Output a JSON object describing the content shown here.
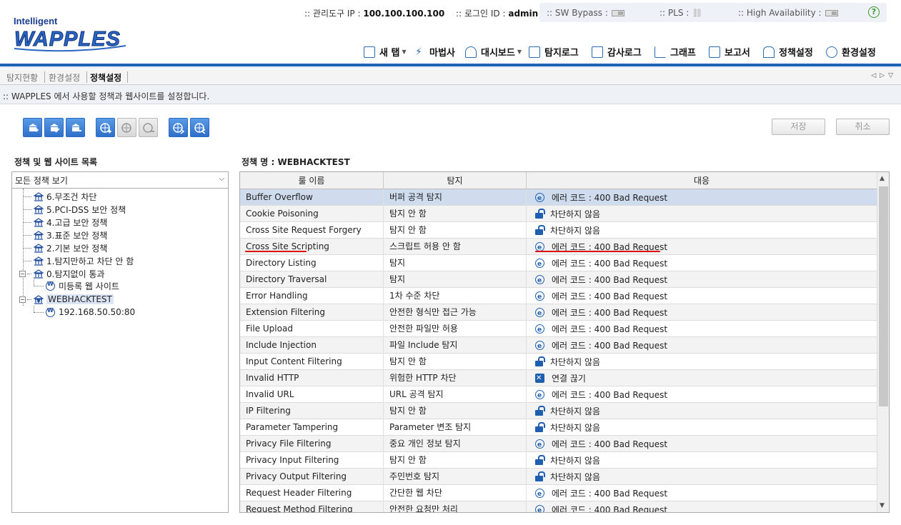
{
  "header": {
    "logo_top": "Intelligent",
    "logo_main": "WAPPLES",
    "mgmt_ip_label": ":: 관리도구 IP :",
    "mgmt_ip": "100.100.100.100",
    "login_label": ":: 로그인 ID :",
    "login_id": "admin",
    "status": {
      "sw_bypass": ":: SW Bypass :",
      "pls": ":: PLS :",
      "ha": ":: High Availability :"
    },
    "help": "?"
  },
  "nav": [
    {
      "label": "새 탭",
      "icon": "new-tab-icon",
      "dropdown": true
    },
    {
      "label": "마법사",
      "icon": "wizard-icon",
      "dropdown": false
    },
    {
      "label": "대시보드",
      "icon": "dashboard-icon",
      "dropdown": true
    },
    {
      "label": "탐지로그",
      "icon": "detect-log-icon",
      "dropdown": false
    },
    {
      "label": "감사로그",
      "icon": "audit-log-icon",
      "dropdown": false
    },
    {
      "label": "그래프",
      "icon": "graph-icon",
      "dropdown": false
    },
    {
      "label": "보고서",
      "icon": "report-icon",
      "dropdown": false
    },
    {
      "label": "정책설정",
      "icon": "policy-icon",
      "dropdown": false
    },
    {
      "label": "환경설정",
      "icon": "gear-icon",
      "dropdown": false
    }
  ],
  "tabs": [
    {
      "label": "탐지현황",
      "active": false
    },
    {
      "label": "환경설정",
      "active": false
    },
    {
      "label": "정책설정",
      "active": true
    }
  ],
  "description": ":: WAPPLES 에서 사용할 정책과 웹사이트를 설정합니다.",
  "buttons": {
    "save": "저장",
    "cancel": "취소"
  },
  "left": {
    "title": "정책 및 웹 사이트 목록",
    "select_value": "모든 정책 보기",
    "tree": [
      {
        "label": "6.무조건 차단",
        "type": "policy",
        "level": 0
      },
      {
        "label": "5.PCI-DSS 보안 정책",
        "type": "policy",
        "level": 0
      },
      {
        "label": "4.고급 보안 정책",
        "type": "policy",
        "level": 0
      },
      {
        "label": "3.표준 보안 정책",
        "type": "policy",
        "level": 0
      },
      {
        "label": "2.기본 보안 정책",
        "type": "policy",
        "level": 0
      },
      {
        "label": "1.탐지만하고 차단 안 함",
        "type": "policy",
        "level": 0
      },
      {
        "label": "0.탐지없이 통과",
        "type": "policy",
        "level": 0,
        "expandable": true
      },
      {
        "label": "미등록 웹 사이트",
        "type": "site",
        "level": 1
      },
      {
        "label": "WEBHACKTEST",
        "type": "policy",
        "level": 0,
        "expandable": true,
        "selected": true
      },
      {
        "label": "192.168.50.50:80",
        "type": "site",
        "level": 1
      }
    ]
  },
  "right": {
    "title": "정책 명 : WEBHACKTEST",
    "columns": [
      "룰 이름",
      "탐지",
      "대응"
    ],
    "rows": [
      {
        "rule": "Buffer Overflow",
        "detect": "버퍼 공격 탐지",
        "action": "에러 코드 : 400 Bad Request",
        "icon": "error-code-icon"
      },
      {
        "rule": "Cookie Poisoning",
        "detect": "탐지 안 함",
        "action": "차단하지 않음",
        "icon": "unlock-icon"
      },
      {
        "rule": "Cross Site Request Forgery",
        "detect": "탐지 안 함",
        "action": "차단하지 않음",
        "icon": "unlock-icon"
      },
      {
        "rule": "Cross Site Scripting",
        "detect": "스크립트 허용 안 함",
        "action": "에러 코드 : 400 Bad Request",
        "icon": "error-code-icon"
      },
      {
        "rule": "Directory Listing",
        "detect": "탐지",
        "action": "에러 코드 : 400 Bad Request",
        "icon": "error-code-icon"
      },
      {
        "rule": "Directory Traversal",
        "detect": "탐지",
        "action": "에러 코드 : 400 Bad Request",
        "icon": "error-code-icon"
      },
      {
        "rule": "Error Handling",
        "detect": "1차 수준 차단",
        "action": "에러 코드 : 400 Bad Request",
        "icon": "error-code-icon"
      },
      {
        "rule": "Extension Filtering",
        "detect": "안전한 형식만 접근 가능",
        "action": "에러 코드 : 400 Bad Request",
        "icon": "error-code-icon"
      },
      {
        "rule": "File Upload",
        "detect": "안전한 파일만 허용",
        "action": "에러 코드 : 400 Bad Request",
        "icon": "error-code-icon"
      },
      {
        "rule": "Include Injection",
        "detect": "파일 Include 탐지",
        "action": "에러 코드 : 400 Bad Request",
        "icon": "error-code-icon"
      },
      {
        "rule": "Input Content Filtering",
        "detect": "탐지 안 함",
        "action": "차단하지 않음",
        "icon": "unlock-icon"
      },
      {
        "rule": "Invalid HTTP",
        "detect": "위험한 HTTP 차단",
        "action": "연결 끊기",
        "icon": "disconnect-icon"
      },
      {
        "rule": "Invalid URL",
        "detect": "URL 공격 탐지",
        "action": "에러 코드 : 400 Bad Request",
        "icon": "error-code-icon"
      },
      {
        "rule": "IP Filtering",
        "detect": "탐지 안 함",
        "action": "차단하지 않음",
        "icon": "unlock-icon"
      },
      {
        "rule": "Parameter Tampering",
        "detect": "Parameter 변조 탐지",
        "action": "차단하지 않음",
        "icon": "unlock-icon"
      },
      {
        "rule": "Privacy File Filtering",
        "detect": "중요 개인 정보 탐지",
        "action": "에러 코드 : 400 Bad Request",
        "icon": "error-code-icon"
      },
      {
        "rule": "Privacy Input Filtering",
        "detect": "탐지 안 함",
        "action": "차단하지 않음",
        "icon": "unlock-icon"
      },
      {
        "rule": "Privacy Output Filtering",
        "detect": "주민번호 탐지",
        "action": "차단하지 않음",
        "icon": "unlock-icon"
      },
      {
        "rule": "Request Header Filtering",
        "detect": "간단한 웹 차단",
        "action": "에러 코드 : 400 Bad Request",
        "icon": "error-code-icon"
      },
      {
        "rule": "Request Method Filtering",
        "detect": "안전한 요청만 처리",
        "action": "에러 코드 : 400 Bad Request",
        "icon": "error-code-icon"
      }
    ]
  },
  "colors": {
    "brand": "#1e63b5",
    "annotation": "#dd0000",
    "selected_row": "#cfdcee"
  }
}
